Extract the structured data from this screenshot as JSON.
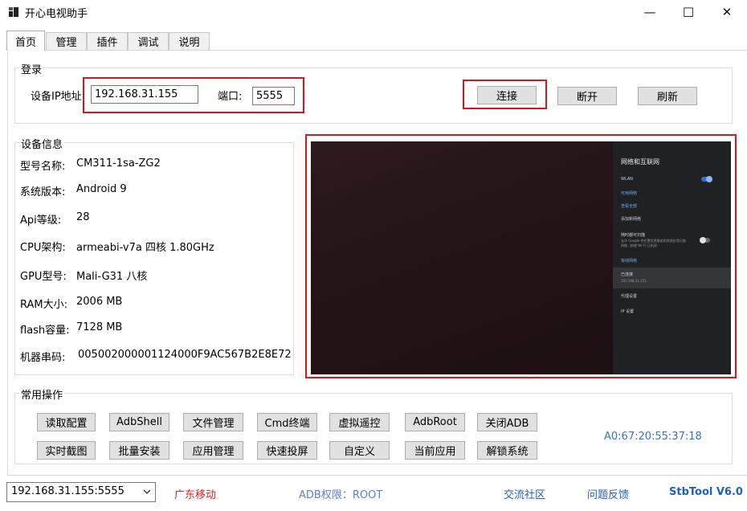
{
  "window": {
    "title": "开心电视助手",
    "controls": {
      "minimize": "—",
      "maximize": "☐",
      "close": "✕"
    }
  },
  "tabs": [
    "首页",
    "管理",
    "插件",
    "调试",
    "说明"
  ],
  "login": {
    "group_label": "登录",
    "ip_label": "设备IP地址",
    "ip_value": "192.168.31.155",
    "port_label": "端口:",
    "port_value": "5555",
    "connect": "连接",
    "disconnect": "断开",
    "refresh": "刷新"
  },
  "device_info": {
    "group_label": "设备信息",
    "rows": [
      {
        "key": "型号名称:",
        "value": "CM311-1sa-ZG2"
      },
      {
        "key": "系统版本:",
        "value": "Android 9"
      },
      {
        "key": "Api等级:",
        "value": "28"
      },
      {
        "key": "CPU架构:",
        "value": "armeabi-v7a 四核 1.80GHz"
      },
      {
        "key": "GPU型号:",
        "value": "Mali-G31 八核"
      },
      {
        "key": "RAM大小:",
        "value": "2006 MB"
      },
      {
        "key": "flash容量:",
        "value": "7128 MB"
      },
      {
        "key": "机器串码:",
        "value": "005002000001124000F9AC567B2E8E72"
      }
    ]
  },
  "tv_screen": {
    "menu_title": "网络和互联网",
    "wlan": "WLAN",
    "available_networks": "可用网络",
    "see_all": "查看全部",
    "add_network": "添加新网络",
    "scan_always": "随时都可扫描",
    "scan_desc_1": "允许 Google 的位置信息服务和其他应用扫描",
    "scan_desc_2": "网络（即使 Wi-Fi 已关闭）",
    "ethernet": "有线网络",
    "connected": "已连接",
    "connected_ip": "192.168.31.155",
    "proxy": "代理设置",
    "ip_settings": "IP 设置",
    "accent": "#4a8ef0"
  },
  "operations": {
    "group_label": "常用操作",
    "row1": [
      "读取配置",
      "AdbShell",
      "文件管理",
      "Cmd终端",
      "虚拟遥控",
      "AdbRoot",
      "关闭ADB"
    ],
    "row2": [
      "实时截图",
      "批量安装",
      "应用管理",
      "快速投屏",
      "自定义",
      "当前应用",
      "解锁系统"
    ],
    "mac": "A0:67:20:55:37:18"
  },
  "statusbar": {
    "device_select": "192.168.31.155:5555",
    "carrier": "广东移动",
    "adb_permission": "ADB权限：ROOT",
    "community": "交流社区",
    "feedback": "问题反馈",
    "version": "StbTool V6.0"
  },
  "colors": {
    "highlight_red": "#d9141b",
    "link_blue": "#1e5fd0",
    "status_red": "#e02020",
    "mac_blue": "#3a6fd0"
  }
}
